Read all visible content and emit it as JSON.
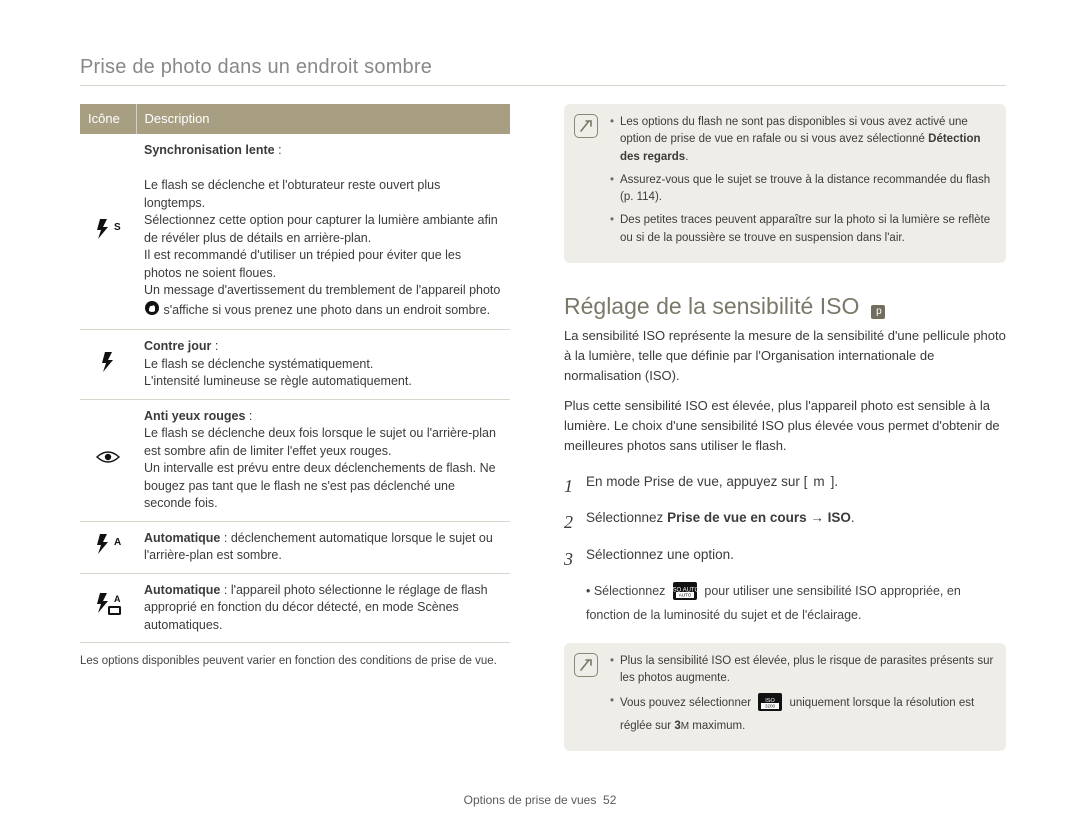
{
  "page_title": "Prise de photo dans un endroit sombre",
  "table": {
    "head": {
      "icon": "Icône",
      "desc": "Description"
    },
    "rows": [
      {
        "icon": "flash-slow",
        "title": "Synchronisation lente",
        "body": "Le flash se déclenche et l'obturateur reste ouvert plus longtemps.\nSélectionnez cette option pour capturer la lumière ambiante afin de révéler plus de détails en arrière-plan.\nIl est recommandé d'utiliser un trépied pour éviter que les photos ne soient floues.\nUn message d'avertissement du tremblement de l'appareil photo  s'affiche si vous prenez une photo dans un endroit sombre."
      },
      {
        "icon": "flash-fill",
        "title": "Contre jour",
        "body": "Le flash se déclenche systématiquement.\nL'intensité lumineuse se règle automatiquement."
      },
      {
        "icon": "eye",
        "title": "Anti yeux rouges",
        "body": "Le flash se déclenche deux fois lorsque le sujet ou l'arrière-plan est sombre afin de limiter l'effet yeux rouges.\nUn intervalle est prévu entre deux déclenchements de flash. Ne bougez pas tant que le flash ne s'est pas déclenché une seconde fois."
      },
      {
        "icon": "flash-auto",
        "title": "Automatique",
        "body": "déclenchement automatique lorsque le sujet ou l'arrière-plan est sombre."
      },
      {
        "icon": "flash-auto-scene",
        "title": "Automatique",
        "body": "l'appareil photo sélectionne le réglage de flash approprié en fonction du décor détecté, en mode Scènes automatiques."
      }
    ],
    "footnote": "Les options disponibles peuvent varier en fonction des conditions de prise de vue."
  },
  "info_top": {
    "items": [
      "Les options du flash ne sont pas disponibles si vous avez activé une option de prise de vue en rafale ou si vous avez sélectionné Détection des regards.",
      "Assurez-vous que le sujet se trouve à la distance recommandée du flash (p. 114).",
      "Des petites traces peuvent apparaître sur la photo si la lumière se reflète ou si de la poussière se trouve en suspension dans l'air."
    ],
    "bold_phrase": "Détection des regards"
  },
  "section": {
    "heading": "Réglage de la sensibilité ISO",
    "mode_mark": "p",
    "para1": "La sensibilité ISO représente la mesure de la sensibilité d'une pellicule photo à la lumière, telle que définie par l'Organisation internationale de normalisation (ISO).",
    "para2": "Plus cette sensibilité ISO est élevée, plus l'appareil photo est sensible à la lumière. Le choix d'une sensibilité ISO plus élevée vous permet d'obtenir de meilleures photos sans utiliser le flash.",
    "steps": [
      {
        "num": "1",
        "text_a": "En mode Prise de vue, appuyez sur [",
        "key": "m",
        "text_b": "]."
      },
      {
        "num": "2",
        "text": "Sélectionnez Prise de vue en cours → ISO.",
        "bold": true
      },
      {
        "num": "3",
        "text": "Sélectionnez une option."
      }
    ],
    "step3_sub": "Sélectionnez  pour utiliser une sensibilité ISO appropriée, en fonction de la luminosité du sujet et de l'éclairage.",
    "iso_auto_label": "ISO AUTO"
  },
  "info_bottom": {
    "items": [
      "Plus la sensibilité ISO est élevée, plus le risque de parasites présents sur les photos augmente.",
      "Vous pouvez sélectionner  uniquement lorsque la résolution est réglée sur 3M maximum."
    ],
    "iso3200_label": "ISO 3200"
  },
  "footer": {
    "section_label": "Options de prise de vues",
    "page": "52"
  }
}
